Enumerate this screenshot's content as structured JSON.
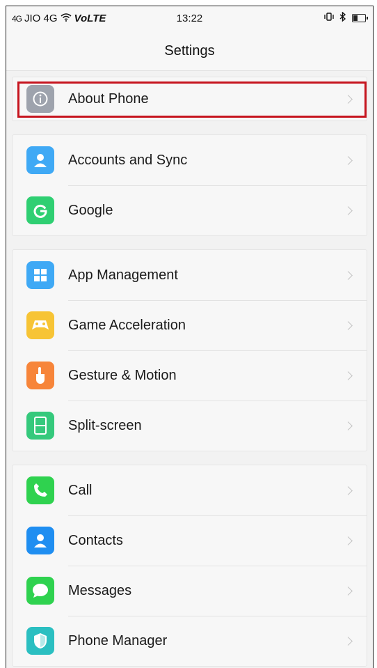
{
  "status_bar": {
    "signal": "4G",
    "carrier": "JIO 4G",
    "volte": "VoLTE",
    "time": "13:22",
    "battery_level": 0.45
  },
  "header": {
    "title": "Settings"
  },
  "groups": [
    {
      "items": [
        {
          "label": "About Phone",
          "icon": "info-icon",
          "color": "#9ea3ad",
          "highlighted": true
        }
      ]
    },
    {
      "items": [
        {
          "label": "Accounts and Sync",
          "icon": "person-icon",
          "color": "#3fa9f5"
        },
        {
          "label": "Google",
          "icon": "google-g-icon",
          "color": "#2fcf72"
        }
      ]
    },
    {
      "items": [
        {
          "label": "App Management",
          "icon": "apps-grid-icon",
          "color": "#3fa9f5"
        },
        {
          "label": "Game Acceleration",
          "icon": "gamepad-icon",
          "color": "#f7c435"
        },
        {
          "label": "Gesture & Motion",
          "icon": "hand-pointer-icon",
          "color": "#f7853a"
        },
        {
          "label": "Split-screen",
          "icon": "split-screen-icon",
          "color": "#35c97c"
        }
      ]
    },
    {
      "items": [
        {
          "label": "Call",
          "icon": "phone-icon",
          "color": "#2fd24f"
        },
        {
          "label": "Contacts",
          "icon": "contacts-icon",
          "color": "#1f8ef1"
        },
        {
          "label": "Messages",
          "icon": "message-bubble-icon",
          "color": "#2fd24f"
        },
        {
          "label": "Phone Manager",
          "icon": "shield-icon",
          "color": "#2bbfc1"
        }
      ]
    }
  ]
}
